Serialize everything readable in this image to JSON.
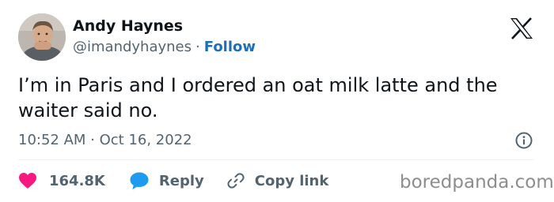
{
  "author": {
    "name": "Andy Haynes",
    "handle": "@imandyhaynes",
    "separator": "·",
    "follow_label": "Follow"
  },
  "tweet": {
    "text": "I’m in Paris and I ordered an oat milk latte and the waiter said no.",
    "timestamp": "10:52 AM · Oct 16, 2022"
  },
  "actions": {
    "likes_count": "164.8K",
    "reply_label": "Reply",
    "copy_link_label": "Copy link"
  },
  "watermark": "boredpanda.com",
  "icons": {
    "platform": "x-logo-icon",
    "info": "info-icon",
    "like": "heart-icon",
    "reply": "reply-bubble-icon",
    "copy": "link-icon"
  },
  "colors": {
    "like": "#f91880",
    "reply": "#1d9bf0",
    "follow": "#1d6fb8",
    "text": "#0f1419",
    "muted": "#536471"
  }
}
